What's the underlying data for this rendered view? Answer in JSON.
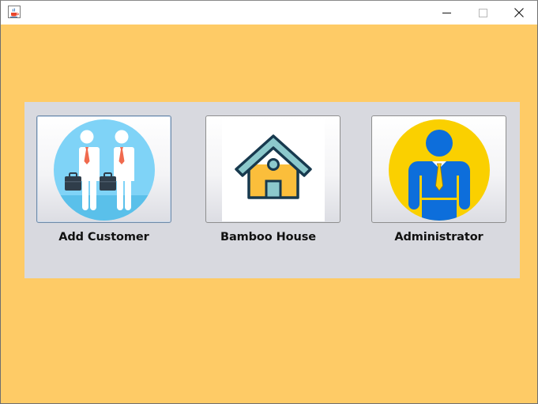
{
  "window": {
    "app_icon": "java-cup-icon",
    "controls": {
      "minimize": "minimize-icon",
      "maximize": "maximize-icon",
      "close": "close-icon"
    }
  },
  "menu": {
    "buttons": [
      {
        "label": "Add Customer",
        "icon": "business-people-icon",
        "focused": true
      },
      {
        "label": "Bamboo House",
        "icon": "house-icon",
        "focused": false
      },
      {
        "label": "Administrator",
        "icon": "administrator-icon",
        "focused": false
      }
    ]
  },
  "colors": {
    "background": "#fecb66",
    "panel": "#d8d9df",
    "admin_circle": "#fad000",
    "admin_figure": "#0d6edb",
    "customer_circle": "#7fd3f7",
    "house_roof": "#8cc9cc",
    "house_wall": "#fbbe3b"
  }
}
